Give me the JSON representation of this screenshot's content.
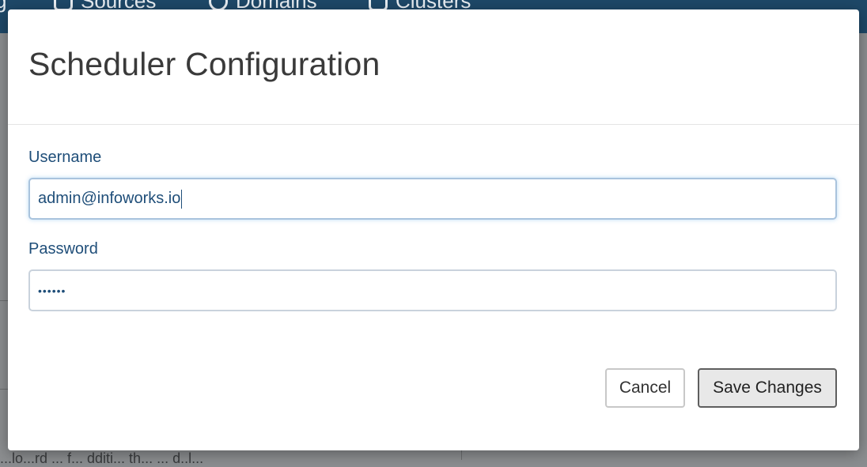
{
  "background": {
    "nav": {
      "items": [
        {
          "label": "g",
          "icon": "none"
        },
        {
          "label": "Sources",
          "icon": "database-icon"
        },
        {
          "label": "Domains",
          "icon": "globe-icon"
        },
        {
          "label": "Clusters",
          "icon": "server-icon"
        }
      ]
    },
    "page_text": "...lo...rd ... f... dditi... th... ... d..l..."
  },
  "modal": {
    "title": "Scheduler Configuration",
    "username": {
      "label": "Username",
      "value": "admin@infoworks.io"
    },
    "password": {
      "label": "Password",
      "value": "••••••"
    },
    "buttons": {
      "cancel": "Cancel",
      "save": "Save Changes"
    }
  },
  "colors": {
    "nav_bg": "#1e4868",
    "label": "#1f4e79",
    "overlay": "#8c8e90"
  }
}
